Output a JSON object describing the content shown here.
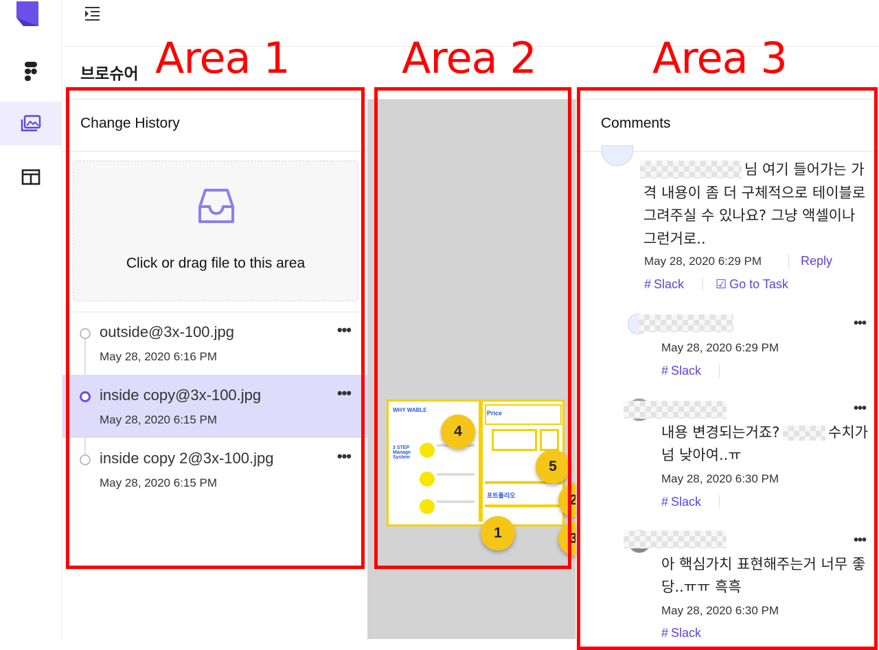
{
  "sidebar": {
    "logo_icon": "app-logo-icon",
    "items": [
      {
        "icon": "figma-icon",
        "active": false
      },
      {
        "icon": "gallery-icon",
        "active": true
      },
      {
        "icon": "layout-icon",
        "active": false
      }
    ]
  },
  "header": {
    "menu_icon": "indent-menu-icon"
  },
  "page_title": "브로슈어",
  "annotations": {
    "area1": "Area 1",
    "area2": "Area 2",
    "area3": "Area 3",
    "color": "#ff0000"
  },
  "history": {
    "heading": "Change History",
    "dropzone_text": "Click or drag file to this area",
    "items": [
      {
        "name": "outside@3x-100.jpg",
        "date": "May 28, 2020 6:16 PM"
      },
      {
        "name": "inside copy@3x-100.jpg",
        "date": "May 28, 2020 6:15 PM",
        "selected": true
      },
      {
        "name": "inside copy 2@3x-100.jpg",
        "date": "May 28, 2020 6:15 PM"
      }
    ],
    "more": "•••"
  },
  "preview": {
    "thumb": {
      "left_title": "WHY WABLE",
      "left_subtitle": "3 STEP Manage System",
      "price_title": "Price",
      "portfolio_title": "포트폴리오"
    },
    "badges": [
      "4",
      "5",
      "2",
      "1",
      "3"
    ]
  },
  "comments": {
    "heading": "Comments",
    "list": [
      {
        "lines": [
          "님 여기 들어가는 가",
          "격 내용이 좀 더 구체적으로 테이블로",
          "그려주실 수 있나요? 그냥 액셀이나",
          "그런거로.."
        ],
        "date": "May 28, 2020 6:29 PM",
        "reply": "Reply",
        "slack": "Slack",
        "task": "Go to Task"
      },
      {
        "date": "May 28, 2020 6:29 PM",
        "slack": "Slack"
      },
      {
        "lines": [
          "내용 변경되는거죠?",
          "수치가",
          "넘 낮아여..ㅠ"
        ],
        "date": "May 28, 2020 6:30 PM",
        "slack": "Slack"
      },
      {
        "lines": [
          "아 핵심가치 표현해주는거 너무 좋",
          "당..ㅠㅠ 흑흑"
        ],
        "date": "May 28, 2020 6:30 PM",
        "slack": "Slack"
      }
    ],
    "more": "•••"
  },
  "colors": {
    "accent": "#5a44e0",
    "selected_bg": "#dfdbfa",
    "badge": "#f5c518"
  }
}
